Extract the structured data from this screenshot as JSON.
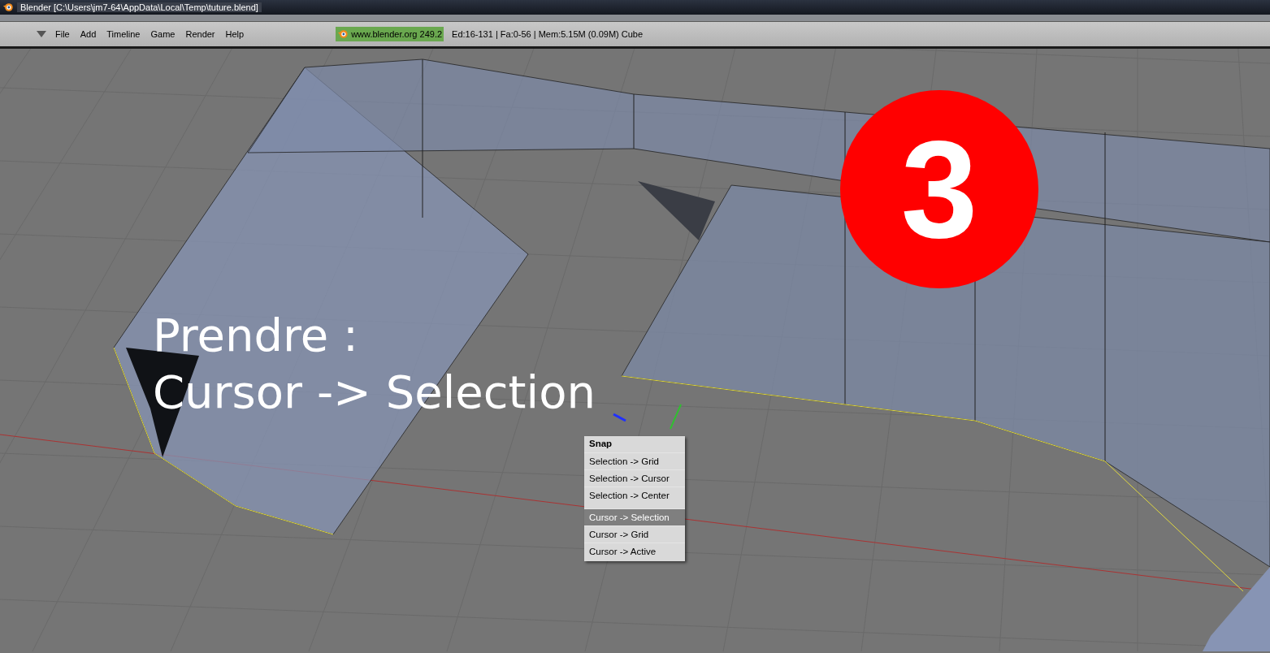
{
  "window": {
    "title": "Blender [C:\\Users\\jm7-64\\AppData\\Local\\Temp\\tuture.blend]"
  },
  "menu_bar": {
    "items": [
      "File",
      "Add",
      "Timeline",
      "Game",
      "Render",
      "Help"
    ]
  },
  "info": {
    "version": "www.blender.org 249.2",
    "stats": "Ed:16-131 | Fa:0-56 | Mem:5.15M (0.09M) Cube"
  },
  "annotation": {
    "lines": [
      "Prendre :",
      "Cursor -> Selection"
    ],
    "step": "3"
  },
  "snap_menu": {
    "title": "Snap",
    "groups": [
      [
        {
          "label": "Selection -> Grid",
          "selected": false
        },
        {
          "label": "Selection -> Cursor",
          "selected": false
        },
        {
          "label": "Selection -> Center",
          "selected": false
        }
      ],
      [
        {
          "label": "Cursor -> Selection",
          "selected": true
        },
        {
          "label": "Cursor -> Grid",
          "selected": false
        },
        {
          "label": "Cursor -> Active",
          "selected": false
        }
      ]
    ]
  }
}
